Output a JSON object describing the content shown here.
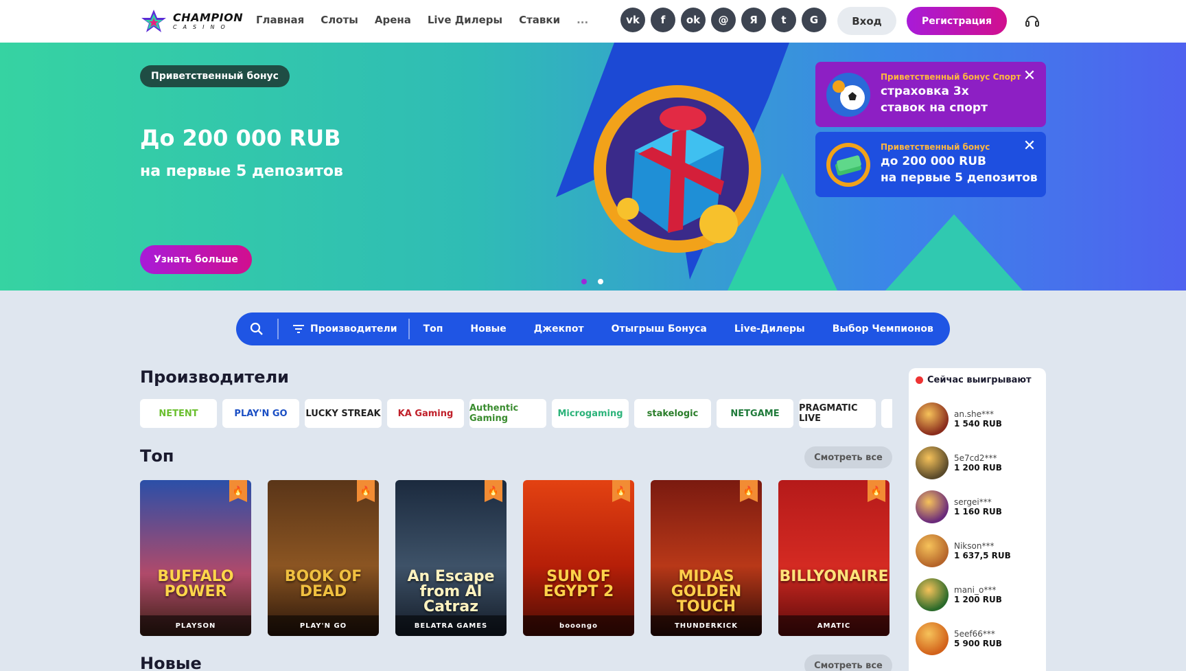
{
  "brand": {
    "line1": "CHAMPION",
    "line2": "CASINO"
  },
  "nav": [
    "Главная",
    "Слоты",
    "Арена",
    "Live Дилеры",
    "Ставки",
    "..."
  ],
  "social": [
    {
      "icon": "vk-icon",
      "glyph": "vk"
    },
    {
      "icon": "facebook-icon",
      "glyph": "f"
    },
    {
      "icon": "odnoklassniki-icon",
      "glyph": "ok"
    },
    {
      "icon": "mail-icon",
      "glyph": "@"
    },
    {
      "icon": "yandex-icon",
      "glyph": "Я"
    },
    {
      "icon": "twitter-icon",
      "glyph": "t"
    },
    {
      "icon": "google-icon",
      "glyph": "G"
    }
  ],
  "header": {
    "login": "Вход",
    "register": "Регистрация"
  },
  "hero": {
    "badge": "Приветственный бонус",
    "title": "До 200 000 RUB",
    "subtitle": "на первые 5 депозитов",
    "cta": "Узнать больше",
    "slides_total": 2,
    "slide_active": 1
  },
  "promos": [
    {
      "tag": "Приветственный бонус Спорт",
      "line1": "страховка 3х",
      "line2": "ставок на спорт"
    },
    {
      "tag": "Приветственный бонус",
      "line1": "до 200 000 RUB",
      "line2": "на первые 5 депозитов"
    }
  ],
  "categories": {
    "providers": "Производители",
    "items": [
      "Топ",
      "Новые",
      "Джекпот",
      "Отыгрыш Бонуса",
      "Live-Дилеры",
      "Выбор Чемпионов"
    ]
  },
  "sections": {
    "providers": "Производители",
    "top": "Топ",
    "new": "Новые",
    "see_all": "Смотреть все"
  },
  "providers": [
    {
      "name": "NETENT",
      "color": "#6abf2e"
    },
    {
      "name": "PLAY'N GO",
      "color": "#1b4fc4"
    },
    {
      "name": "LUCKY STREAK",
      "color": "#222"
    },
    {
      "name": "KA Gaming",
      "color": "#c0202a"
    },
    {
      "name": "Authentic Gaming",
      "color": "#3a8c2f"
    },
    {
      "name": "Microgaming",
      "color": "#2cb37a"
    },
    {
      "name": "stakelogic",
      "color": "#2a7d2a"
    },
    {
      "name": "NETGAME",
      "color": "#1f7a3a"
    },
    {
      "name": "PRAGMATIC LIVE",
      "color": "#222"
    }
  ],
  "top_games": [
    {
      "title": "BUFFALO POWER",
      "provider": "PLAYSON",
      "bg": "linear-gradient(180deg,#2b4fa8,#b04a6a 60%,#3a1e14)",
      "color": "#ffd64a"
    },
    {
      "title": "BOOK OF DEAD",
      "provider": "PLAY'N GO",
      "bg": "linear-gradient(180deg,#5a3518,#8b5522 55%,#2a160a)",
      "color": "#f0c040"
    },
    {
      "title": "An Escape from Al Catraz",
      "provider": "BELATRA GAMES",
      "bg": "linear-gradient(180deg,#1b2a3e,#3e5268 55%,#141c28)",
      "color": "#fff3c0"
    },
    {
      "title": "SUN OF EGYPT 2",
      "provider": "booongo",
      "bg": "linear-gradient(180deg,#e34212,#b61f08 55%,#4a0c04)",
      "color": "#ffd24a"
    },
    {
      "title": "MIDAS GOLDEN TOUCH",
      "provider": "THUNDERKICK",
      "bg": "linear-gradient(180deg,#7a1a10,#b83818 55%,#2b0a06)",
      "color": "#ffcf4a"
    },
    {
      "title": "BILLYONAIRE",
      "provider": "AMATIC",
      "bg": "linear-gradient(180deg,#b51a1a,#d42a22 55%,#5a0a0a)",
      "color": "#ffe37a"
    }
  ],
  "winners": {
    "title": "Сейчас выигрывают",
    "list": [
      {
        "user": "an.she***",
        "amount": "1 540 RUB",
        "color": "#8a2c1c"
      },
      {
        "user": "5e7cd2***",
        "amount": "1 200 RUB",
        "color": "#5a4a2a"
      },
      {
        "user": "sergei***",
        "amount": "1 160 RUB",
        "color": "#6a2a7a"
      },
      {
        "user": "Nikson***",
        "amount": "1 637,5 RUB",
        "color": "#b5652a"
      },
      {
        "user": "mani_o***",
        "amount": "1 200 RUB",
        "color": "#2a6a2a"
      },
      {
        "user": "5eef66***",
        "amount": "5 900 RUB",
        "color": "#d2621a"
      }
    ]
  }
}
